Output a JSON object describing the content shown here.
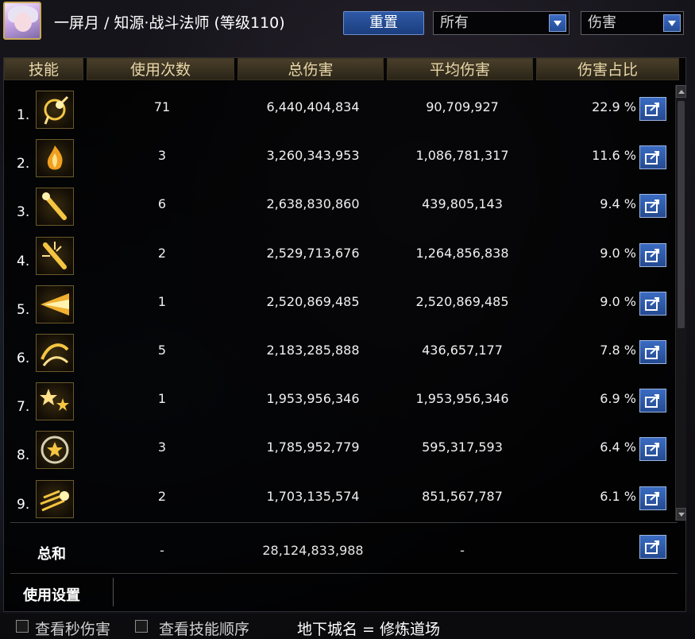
{
  "header": {
    "title": "一屏月 / 知源·战斗法师 (等级110)",
    "reset_label": "重置",
    "filter_value": "所有",
    "type_value": "伤害"
  },
  "columns": [
    "技能",
    "使用次数",
    "总伤害",
    "平均伤害",
    "伤害占比"
  ],
  "rows": [
    {
      "rank": "1.",
      "icon": "orbit-star-skill-icon",
      "count": "71",
      "total": "6,440,404,834",
      "avg": "90,709,927",
      "pct": "22.9 %"
    },
    {
      "rank": "2.",
      "icon": "flame-burst-skill-icon",
      "count": "3",
      "total": "3,260,343,953",
      "avg": "1,086,781,317",
      "pct": "11.6 %"
    },
    {
      "rank": "3.",
      "icon": "staff-strike-skill-icon",
      "count": "6",
      "total": "2,638,830,860",
      "avg": "439,805,143",
      "pct": "9.4 %"
    },
    {
      "rank": "4.",
      "icon": "staff-radiant-skill-icon",
      "count": "2",
      "total": "2,529,713,676",
      "avg": "1,264,856,838",
      "pct": "9.0 %"
    },
    {
      "rank": "5.",
      "icon": "light-beam-skill-icon",
      "count": "1",
      "total": "2,520,869,485",
      "avg": "2,520,869,485",
      "pct": "9.0 %"
    },
    {
      "rank": "6.",
      "icon": "swirl-slash-skill-icon",
      "count": "5",
      "total": "2,183,285,888",
      "avg": "436,657,177",
      "pct": "7.8 %"
    },
    {
      "rank": "7.",
      "icon": "star-shower-skill-icon",
      "count": "1",
      "total": "1,953,956,346",
      "avg": "1,953,956,346",
      "pct": "6.9 %"
    },
    {
      "rank": "8.",
      "icon": "star-ring-skill-icon",
      "count": "3",
      "total": "1,785,952,779",
      "avg": "595,317,593",
      "pct": "6.4 %"
    },
    {
      "rank": "9.",
      "icon": "meteor-dash-skill-icon",
      "count": "2",
      "total": "1,703,135,574",
      "avg": "851,567,787",
      "pct": "6.1 %"
    }
  ],
  "total": {
    "label": "总和",
    "count": "-",
    "total": "28,124,833,988",
    "avg": "-"
  },
  "settings_label": "使用设置",
  "footer": {
    "checkbox1_label": "查看秒伤害",
    "checkbox2_label": "查看技能顺序",
    "dungeon_label": "地下城名 = 修炼道场"
  },
  "colors": {
    "accent_blue": "#2e5aa6",
    "gold": "#caa85a",
    "header_text": "#e8d7a8"
  }
}
